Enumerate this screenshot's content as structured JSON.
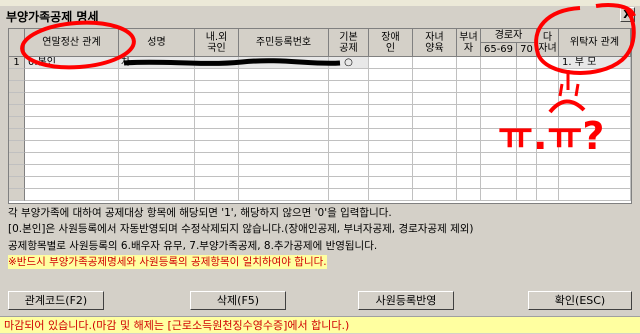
{
  "window": {
    "title": "부양가족공제 명세",
    "close": "X"
  },
  "grid": {
    "headers": {
      "rowno": "",
      "relation": "연말정산 관계",
      "name": "성명",
      "nation": "내.외\n국인",
      "rrn": "주민등록번호",
      "basic": "기본\n공제",
      "disabled": "장애\n인",
      "child": "자녀\n양육",
      "woman": "부녀\n자",
      "elder": "경로자",
      "elder_sub": "65-69",
      "elder_sub2": "70",
      "multichild": "다\n자녀",
      "consign": "위탁자 관계"
    },
    "rows": [
      {
        "no": "1",
        "relation": "0.본인",
        "name": "차",
        "basic": "○",
        "consign": "1. 부 모"
      }
    ]
  },
  "notes": [
    "각 부양가족에 대하여 공제대상 항목에 해당되면 '1', 해당하지 않으면 '0'을 입력합니다.",
    "[0.본인]은 사원등록에서 자동반영되며 수정삭제되지 않습니다.(장애인공제, 부녀자공제, 경로자공제 제외)",
    "공제항목별로 사원등록의 6.배우자 유무, 7.부양가족공제, 8.추가공제에 반영됩니다.",
    "※반드시 부양가족공제명세와 사원등록의 공제항목이 일치하여야 합니다."
  ],
  "buttons": {
    "relation_code": "관계코드(F2)",
    "delete": "삭제(F5)",
    "apply": "사원등록반영",
    "ok": "확인(ESC)"
  },
  "status": "마감되어 있습니다.(마감 및 해제는 [근로소득원천징수영수증]에서 합니다.)",
  "annotation": {
    "text": "ㅠ.ㅠ?",
    "color": "#ff0000"
  }
}
